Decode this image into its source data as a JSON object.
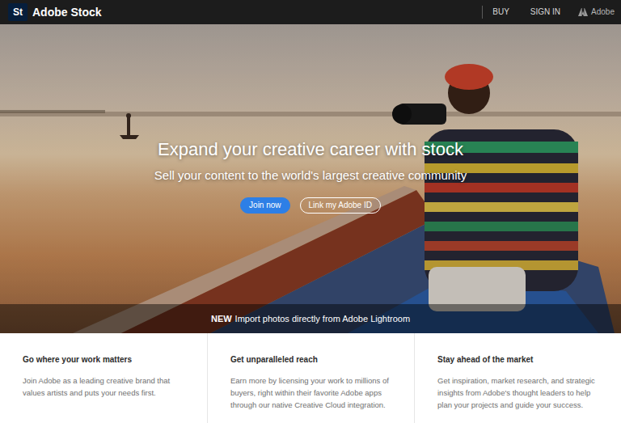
{
  "header": {
    "logo_mark": "St",
    "brand": "Adobe Stock",
    "nav": [
      "BUY",
      "SIGN IN"
    ],
    "adobe": "Adobe"
  },
  "hero": {
    "title": "Expand your creative career with stock",
    "subtitle": "Sell your content to the world's largest creative community",
    "buttons": [
      {
        "label": "Join now",
        "kind": "primary"
      },
      {
        "label": "Link my Adobe ID",
        "kind": "outline"
      }
    ],
    "banner": {
      "badge": "NEW",
      "text": "Import photos directly from Adobe Lightroom"
    }
  },
  "features": [
    {
      "title": "Go where your work matters",
      "body": "Join Adobe as a leading creative brand that values artists and puts your needs first."
    },
    {
      "title": "Get unparalleled reach",
      "body": "Earn more by licensing your work to millions of buyers, right within their favorite Adobe apps through our native Creative Cloud integration."
    },
    {
      "title": "Stay ahead of the market",
      "body": "Get inspiration, market research, and strategic insights from Adobe's thought leaders to help plan your projects and guide your success."
    }
  ]
}
